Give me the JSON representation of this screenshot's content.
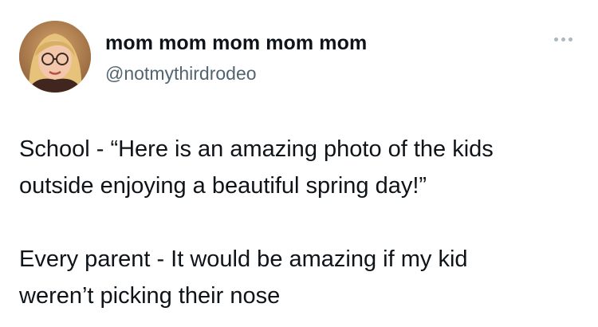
{
  "author": {
    "display_name": "mom mom mom mom mom",
    "handle": "@notmythirdrodeo",
    "avatar_icon": "profile-photo"
  },
  "more_icon": "more-horizontal-icon",
  "tweet": {
    "paragraphs": [
      "School - “Here is an amazing photo of the kids\noutside enjoying a beautiful spring day!”",
      "Every parent - It would be amazing if my kid\nweren’t picking their nose"
    ]
  },
  "colors": {
    "text": "#0f1419",
    "secondary": "#536471",
    "more_dots": "#aab8c2"
  }
}
